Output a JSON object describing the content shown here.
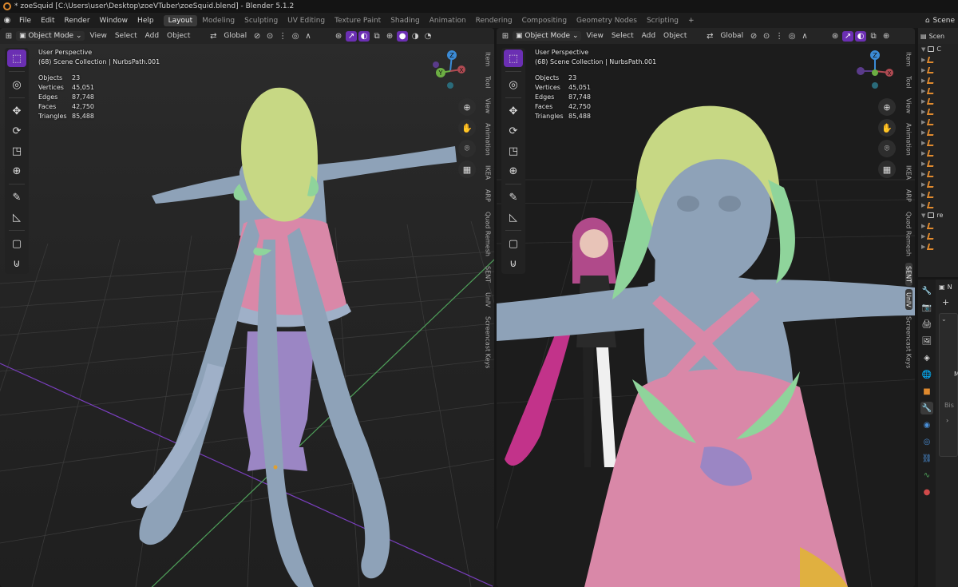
{
  "window": {
    "title": "* zoeSquid [C:\\Users\\user\\Desktop\\zoeVTuber\\zoeSquid.blend] - Blender 5.1.2"
  },
  "menu": [
    "File",
    "Edit",
    "Render",
    "Window",
    "Help"
  ],
  "workspaces": [
    "Layout",
    "Modeling",
    "Sculpting",
    "UV Editing",
    "Texture Paint",
    "Shading",
    "Animation",
    "Rendering",
    "Compositing",
    "Geometry Nodes",
    "Scripting"
  ],
  "active_workspace": "Layout",
  "scene": {
    "label": "Scene"
  },
  "viewports": [
    {
      "header": {
        "mode": "Object Mode",
        "menus": [
          "View",
          "Select",
          "Add",
          "Object"
        ],
        "orientation": "Global"
      },
      "info": {
        "perspective": "User Perspective",
        "collection": "(68) Scene Collection | NurbsPath.001"
      },
      "stats": [
        {
          "label": "Objects",
          "value": "23"
        },
        {
          "label": "Vertices",
          "value": "45,051"
        },
        {
          "label": "Edges",
          "value": "87,748"
        },
        {
          "label": "Faces",
          "value": "42,750"
        },
        {
          "label": "Triangles",
          "value": "85,488"
        }
      ],
      "gizmo": {
        "z": "Z",
        "y": "Y",
        "x": "X"
      },
      "sidetabs": [
        "Item",
        "Tool",
        "View",
        "Animation",
        "IKEA",
        "ARP",
        "Quad Remesh",
        "SENT",
        "UnIV",
        "Screencast Keys"
      ]
    },
    {
      "header": {
        "mode": "Object Mode",
        "menus": [
          "View",
          "Select",
          "Add",
          "Object"
        ],
        "orientation": "Global"
      },
      "info": {
        "perspective": "User Perspective",
        "collection": "(68) Scene Collection | NurbsPath.001"
      },
      "stats": [
        {
          "label": "Objects",
          "value": "23"
        },
        {
          "label": "Vertices",
          "value": "45,051"
        },
        {
          "label": "Edges",
          "value": "87,748"
        },
        {
          "label": "Faces",
          "value": "42,750"
        },
        {
          "label": "Triangles",
          "value": "85,488"
        }
      ],
      "gizmo": {
        "z": "Z",
        "y": "Y",
        "x": "X"
      },
      "sidetabs": [
        "Item",
        "Tool",
        "View",
        "Animation",
        "IKEA",
        "ARP",
        "Quad Remesh",
        "SENT",
        "UnIV",
        "Screencast Keys"
      ]
    }
  ],
  "outliner": {
    "header": "Scen",
    "rows": [
      "C",
      "re"
    ]
  },
  "properties": {
    "header": "N",
    "plus": "+",
    "m": "M",
    "bis": "Bis"
  },
  "icons": {
    "tools": [
      "select-box-icon",
      "cursor-icon",
      "move-icon",
      "rotate-icon",
      "scale-icon",
      "transform-icon",
      "annotate-icon",
      "measure-icon",
      "add-cube-icon",
      "uv-icon"
    ],
    "nav": [
      "zoom-icon",
      "hand-pan-icon",
      "camera-icon",
      "grid-ortho-icon"
    ]
  },
  "colors": {
    "accent": "#6b2fb3",
    "skin": "#8ea2b8",
    "hair": "#c7d884",
    "dress": "#d988a8",
    "stockings": "#9b86c4",
    "leaf": "#8fd49b"
  }
}
